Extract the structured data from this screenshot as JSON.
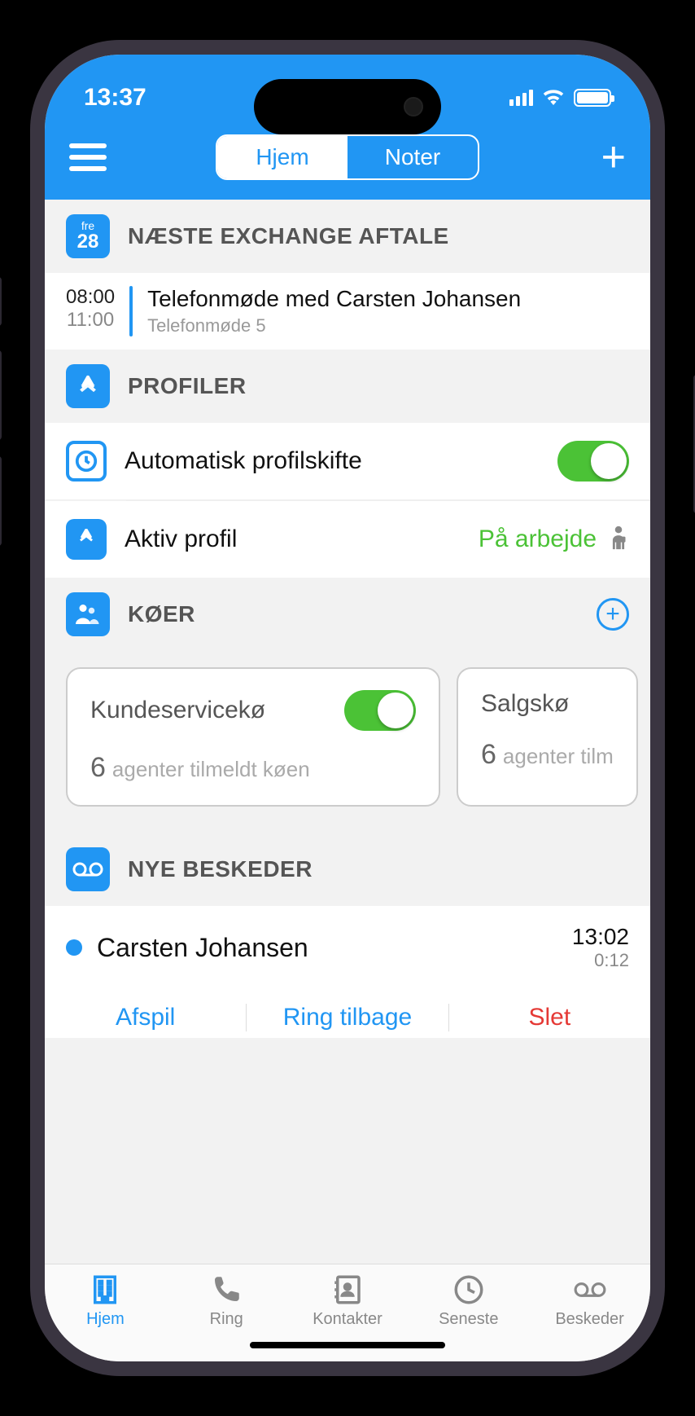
{
  "status": {
    "time": "13:37"
  },
  "nav": {
    "tabs": [
      "Hjem",
      "Noter"
    ],
    "active_index": 0
  },
  "sections": {
    "exchange": {
      "cal_day": "fre",
      "cal_num": "28",
      "title": "NÆSTE EXCHANGE AFTALE",
      "appt": {
        "start": "08:00",
        "end": "11:00",
        "title": "Telefonmøde med Carsten Johansen",
        "subtitle": "Telefonmøde 5"
      }
    },
    "profiler": {
      "title": "PROFILER",
      "rows": {
        "auto": {
          "label": "Automatisk profilskifte",
          "on": true
        },
        "active": {
          "label": "Aktiv profil",
          "value": "På arbejde"
        }
      }
    },
    "queues": {
      "title": "KØER",
      "cards": [
        {
          "name": "Kundeservicekø",
          "count": "6",
          "text": "agenter tilmeldt køen",
          "on": true
        },
        {
          "name": "Salgskø",
          "count": "6",
          "text": "agenter tilm"
        }
      ]
    },
    "messages": {
      "title": "NYE BESKEDER",
      "item": {
        "name": "Carsten Johansen",
        "time": "13:02",
        "duration": "0:12"
      },
      "actions": {
        "play": "Afspil",
        "callback": "Ring tilbage",
        "delete": "Slet"
      }
    }
  },
  "tabbar": {
    "items": [
      {
        "label": "Hjem"
      },
      {
        "label": "Ring"
      },
      {
        "label": "Kontakter"
      },
      {
        "label": "Seneste"
      },
      {
        "label": "Beskeder"
      }
    ],
    "active_index": 0
  }
}
